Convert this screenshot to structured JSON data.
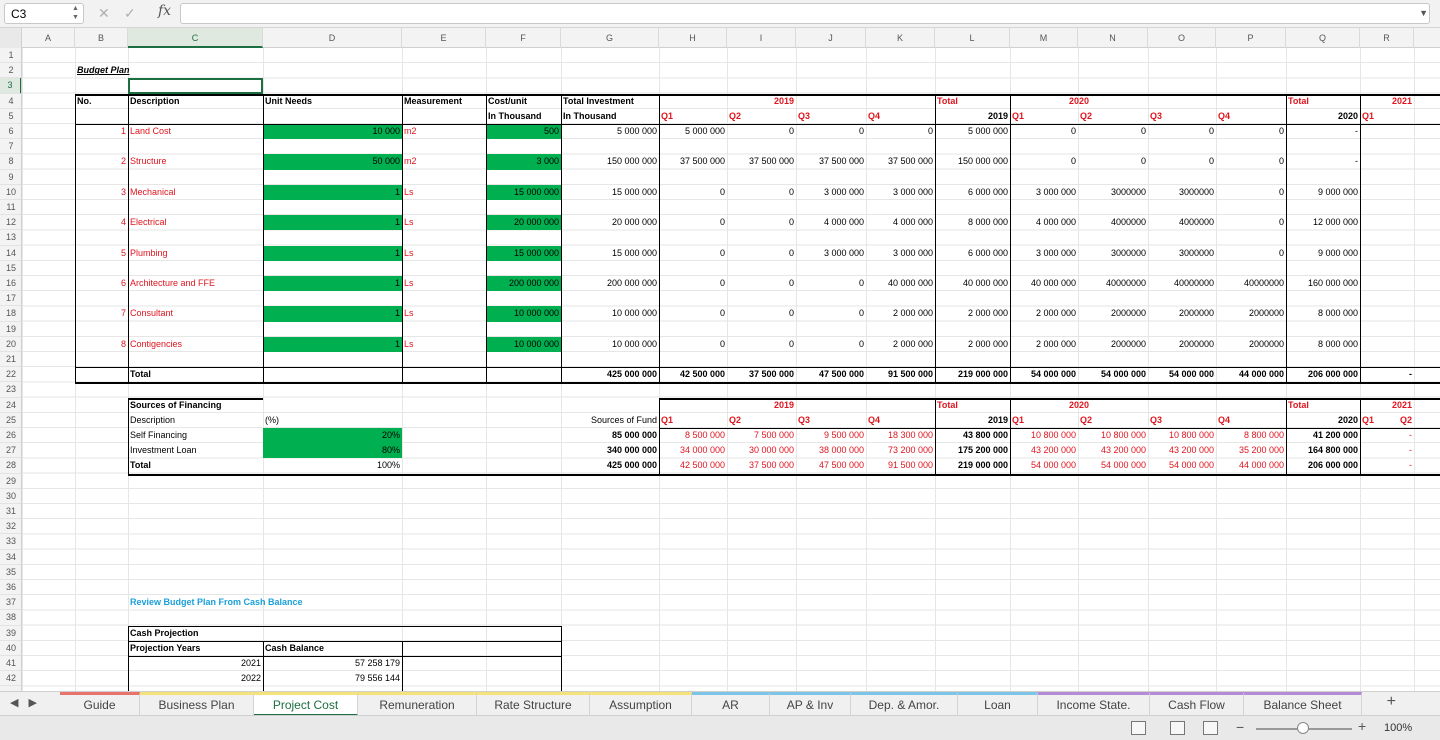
{
  "formula_bar": {
    "name_box": "C3",
    "cancel": "✕",
    "confirm": "✓",
    "fx": "fx",
    "value": ""
  },
  "columns": [
    "A",
    "B",
    "C",
    "D",
    "E",
    "F",
    "G",
    "H",
    "I",
    "J",
    "K",
    "L",
    "M",
    "N",
    "O",
    "P",
    "Q",
    "R"
  ],
  "rows": [
    "1",
    "2",
    "3",
    "4",
    "5",
    "6",
    "7",
    "8",
    "9",
    "10",
    "11",
    "12",
    "13",
    "14",
    "15",
    "16",
    "17",
    "18",
    "19",
    "20",
    "21",
    "22",
    "23",
    "24",
    "25",
    "26",
    "27",
    "28",
    "29",
    "30",
    "31",
    "32",
    "33",
    "34",
    "35",
    "36",
    "37",
    "38",
    "39",
    "40",
    "41",
    "42"
  ],
  "sheet": {
    "title": "Budget Plan",
    "headers": {
      "no": "No.",
      "description": "Description",
      "unit_needs": "Unit Needs",
      "measurement": "Measurement",
      "cost_unit_1": "Cost/unit",
      "cost_unit_2": "In Thousand",
      "total_inv_1": "Total Investment",
      "total_inv_2": "In Thousand",
      "y2019": "2019",
      "y2020": "2020",
      "y2021": "2021",
      "total": "Total",
      "total_2019": "2019",
      "total_2020": "2020",
      "q1": "Q1",
      "q2": "Q2",
      "q3": "Q3",
      "q4": "Q4"
    },
    "items": [
      {
        "no": "1",
        "desc": "Land Cost",
        "units": "10 000",
        "meas": "m2",
        "cost": "500",
        "total": "5 000 000",
        "q2019": [
          "5 000 000",
          "0",
          "0",
          "0"
        ],
        "t2019": "5 000 000",
        "q2020": [
          "0",
          "0",
          "0",
          "0"
        ],
        "t2020": "-"
      },
      {
        "no": "2",
        "desc": "Structure",
        "units": "50 000",
        "meas": "m2",
        "cost": "3 000",
        "total": "150 000 000",
        "q2019": [
          "37 500 000",
          "37 500 000",
          "37 500 000",
          "37 500 000"
        ],
        "t2019": "150 000 000",
        "q2020": [
          "0",
          "0",
          "0",
          "0"
        ],
        "t2020": "-"
      },
      {
        "no": "3",
        "desc": "Mechanical",
        "units": "1",
        "meas": "Ls",
        "cost": "15 000 000",
        "total": "15 000 000",
        "q2019": [
          "0",
          "0",
          "3 000 000",
          "3 000 000"
        ],
        "t2019": "6 000 000",
        "q2020": [
          "3 000 000",
          "3000000",
          "3000000",
          "0"
        ],
        "t2020": "9 000 000"
      },
      {
        "no": "4",
        "desc": "Electrical",
        "units": "1",
        "meas": "Ls",
        "cost": "20 000 000",
        "total": "20 000 000",
        "q2019": [
          "0",
          "0",
          "4 000 000",
          "4 000 000"
        ],
        "t2019": "8 000 000",
        "q2020": [
          "4 000 000",
          "4000000",
          "4000000",
          "0"
        ],
        "t2020": "12 000 000"
      },
      {
        "no": "5",
        "desc": "Plumbing",
        "units": "1",
        "meas": "Ls",
        "cost": "15 000 000",
        "total": "15 000 000",
        "q2019": [
          "0",
          "0",
          "3 000 000",
          "3 000 000"
        ],
        "t2019": "6 000 000",
        "q2020": [
          "3 000 000",
          "3000000",
          "3000000",
          "0"
        ],
        "t2020": "9 000 000"
      },
      {
        "no": "6",
        "desc": "Architecture and FFE",
        "units": "1",
        "meas": "Ls",
        "cost": "200 000 000",
        "total": "200 000 000",
        "q2019": [
          "0",
          "0",
          "0",
          "40 000 000"
        ],
        "t2019": "40 000 000",
        "q2020": [
          "40 000 000",
          "40000000",
          "40000000",
          "40000000"
        ],
        "t2020": "160 000 000"
      },
      {
        "no": "7",
        "desc": "Consultant",
        "units": "1",
        "meas": "Ls",
        "cost": "10 000 000",
        "total": "10 000 000",
        "q2019": [
          "0",
          "0",
          "0",
          "2 000 000"
        ],
        "t2019": "2 000 000",
        "q2020": [
          "2 000 000",
          "2000000",
          "2000000",
          "2000000"
        ],
        "t2020": "8 000 000"
      },
      {
        "no": "8",
        "desc": "Contigencies",
        "units": "1",
        "meas": "Ls",
        "cost": "10 000 000",
        "total": "10 000 000",
        "q2019": [
          "0",
          "0",
          "0",
          "2 000 000"
        ],
        "t2019": "2 000 000",
        "q2020": [
          "2 000 000",
          "2000000",
          "2000000",
          "2000000"
        ],
        "t2020": "8 000 000"
      }
    ],
    "total_row": {
      "label": "Total",
      "total": "425 000 000",
      "q2019": [
        "42 500 000",
        "37 500 000",
        "47 500 000",
        "91 500 000"
      ],
      "t2019": "219 000 000",
      "q2020": [
        "54 000 000",
        "54 000 000",
        "54 000 000",
        "44 000 000"
      ],
      "t2020": "206 000 000",
      "r": "-"
    },
    "financing": {
      "title": "Sources of Financing",
      "desc_label": "Description",
      "pct_label": "(%)",
      "fund_label": "Sources of Fund",
      "rows": [
        {
          "desc": "Self Financing",
          "pct": "20%",
          "fund": "85 000 000",
          "q2019": [
            "8 500 000",
            "7 500 000",
            "9 500 000",
            "18 300 000"
          ],
          "t2019": "43 800 000",
          "q2020": [
            "10 800 000",
            "10 800 000",
            "10 800 000",
            "8 800 000"
          ],
          "t2020": "41 200 000",
          "r": "-"
        },
        {
          "desc": "Investment Loan",
          "pct": "80%",
          "fund": "340 000 000",
          "q2019": [
            "34 000 000",
            "30 000 000",
            "38 000 000",
            "73 200 000"
          ],
          "t2019": "175 200 000",
          "q2020": [
            "43 200 000",
            "43 200 000",
            "43 200 000",
            "35 200 000"
          ],
          "t2020": "164 800 000",
          "r": "-"
        },
        {
          "desc": "Total",
          "pct": "100%",
          "fund": "425 000 000",
          "q2019": [
            "42 500 000",
            "37 500 000",
            "47 500 000",
            "91 500 000"
          ],
          "t2019": "219 000 000",
          "q2020": [
            "54 000 000",
            "54 000 000",
            "54 000 000",
            "44 000 000"
          ],
          "t2020": "206 000 000",
          "r": "-"
        }
      ]
    },
    "review_title": "Review Budget Plan From Cash Balance",
    "cash": {
      "title": "Cash Projection",
      "years_label": "Projection Years",
      "balance_label": "Cash Balance",
      "rows": [
        {
          "year": "2021",
          "balance": "57 258 179"
        },
        {
          "year": "2022",
          "balance": "79 556 144"
        }
      ]
    }
  },
  "tabs": [
    "Guide",
    "Business Plan",
    "Project Cost",
    "Remuneration",
    "Rate Structure",
    "Assumption",
    "AR",
    "AP & Inv",
    "Dep. & Amor.",
    "Loan",
    "Income State.",
    "Cash Flow",
    "Balance Sheet"
  ],
  "tab_colors": [
    "#e8736c",
    "#f5e27a",
    "#f5e27a",
    "#f5e27a",
    "#f5e27a",
    "#f5e27a",
    "#7cc4e8",
    "#7cc4e8",
    "#7cc4e8",
    "#7cc4e8",
    "#b58ad6",
    "#b58ad6",
    "#b58ad6"
  ],
  "active_tab": "Project Cost",
  "add_sheet": "+",
  "zoom": {
    "minus": "−",
    "plus": "+",
    "value": "100%"
  }
}
